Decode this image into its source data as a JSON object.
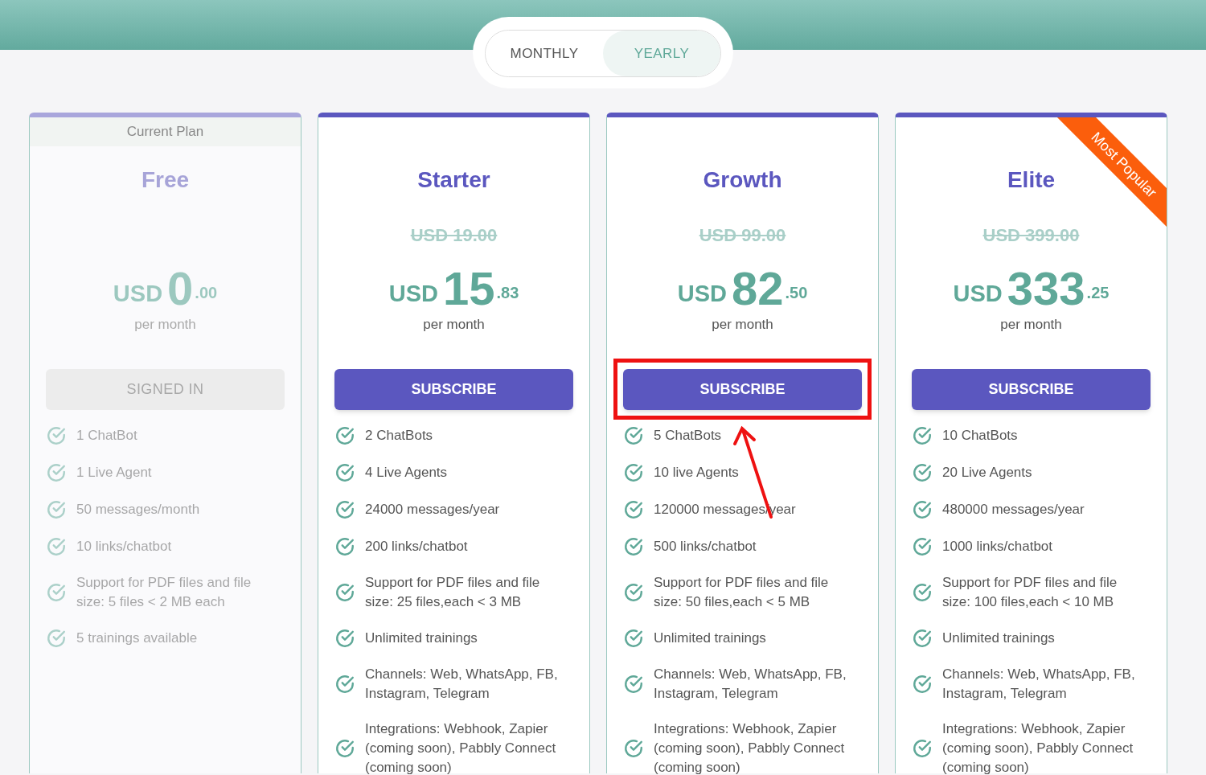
{
  "billing_toggle": [
    {
      "label": "MONTHLY",
      "selected": false
    },
    {
      "label": "YEARLY",
      "selected": true
    }
  ],
  "plans": [
    {
      "name": "Free",
      "current": true,
      "current_label": "Current Plan",
      "currency": "USD",
      "whole": "0",
      "cents": ".00",
      "period": "per month",
      "button": {
        "label": "SIGNED IN",
        "disabled": true
      },
      "highlighted": false,
      "features": [
        "1 ChatBot",
        "1 Live Agent",
        "50 messages/month",
        "10 links/chatbot",
        "Support for PDF files and file size: 5 files < 2 MB each",
        "5 trainings available"
      ]
    },
    {
      "name": "Starter",
      "current": false,
      "old_price": "USD 19.00",
      "currency": "USD",
      "whole": "15",
      "cents": ".83",
      "period": "per month",
      "button": {
        "label": "SUBSCRIBE",
        "disabled": false
      },
      "highlighted": false,
      "features": [
        "2 ChatBots",
        "4 Live Agents",
        "24000 messages/year",
        "200 links/chatbot",
        "Support for PDF files and file size: 25 files,each < 3 MB",
        "Unlimited trainings",
        "Channels: Web, WhatsApp, FB, Instagram, Telegram",
        "Integrations: Webhook, Zapier (coming soon), Pabbly Connect (coming soon)"
      ]
    },
    {
      "name": "Growth",
      "current": false,
      "old_price": "USD 99.00",
      "currency": "USD",
      "whole": "82",
      "cents": ".50",
      "period": "per month",
      "button": {
        "label": "SUBSCRIBE",
        "disabled": false
      },
      "highlighted": true,
      "features": [
        "5 ChatBots",
        "10 live Agents",
        "120000 messages/year",
        "500 links/chatbot",
        "Support for PDF files and file size: 50 files,each < 5 MB",
        "Unlimited trainings",
        "Channels: Web, WhatsApp, FB, Instagram, Telegram",
        "Integrations: Webhook, Zapier (coming soon), Pabbly Connect (coming soon)"
      ]
    },
    {
      "name": "Elite",
      "current": false,
      "old_price": "USD 399.00",
      "ribbon": "Most Popular",
      "currency": "USD",
      "whole": "333",
      "cents": ".25",
      "period": "per month",
      "button": {
        "label": "SUBSCRIBE",
        "disabled": false
      },
      "highlighted": false,
      "features": [
        "10 ChatBots",
        "20 Live Agents",
        "480000 messages/year",
        "1000 links/chatbot",
        "Support for PDF files and file size: 100 files,each < 10 MB",
        "Unlimited trainings",
        "Channels: Web, WhatsApp, FB, Instagram, Telegram",
        "Integrations: Webhook, Zapier (coming soon), Pabbly Connect (coming soon)"
      ]
    }
  ]
}
